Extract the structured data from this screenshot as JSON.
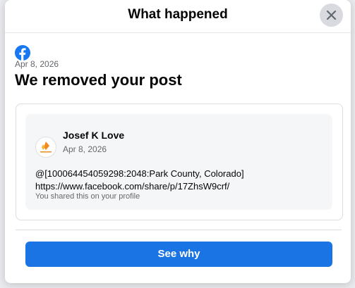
{
  "modal": {
    "title": "What happened",
    "close_icon": "close-icon",
    "brand_icon": "facebook-logo-icon",
    "brand_color": "#1877f2"
  },
  "notice": {
    "date": "Apr 8, 2026",
    "heading": "We removed your post"
  },
  "post": {
    "author": "Josef K Love",
    "date": "Apr 8, 2026",
    "line1": "@[100064454059298:2048:Park County, Colorado]",
    "line2": "https://www.facebook.com/share/p/17ZhsW9crf/",
    "subtext": "You shared this on your profile"
  },
  "actions": {
    "see_why_label": "See why",
    "button_color": "#1b74e4"
  }
}
